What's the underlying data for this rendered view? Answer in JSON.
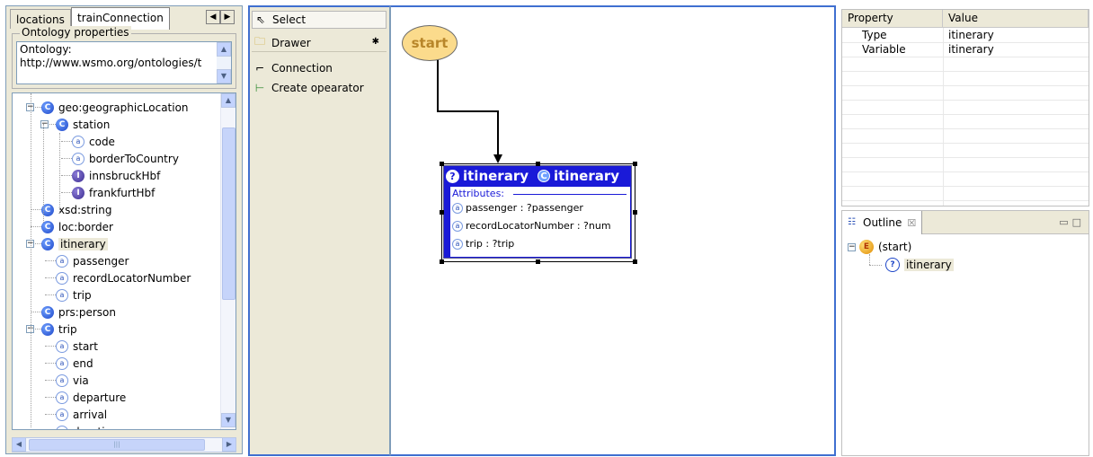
{
  "left_panel": {
    "tabs": [
      "locations",
      "trainConnection"
    ],
    "active_tab": 1,
    "ontology_group_title": "Ontology properties",
    "ontology_label": "Ontology:",
    "ontology_value": "http://www.wsmo.org/ontologies/t",
    "tree": [
      {
        "label": "geo:geographicLocation",
        "icon": "class-icon",
        "level": 1,
        "toggle": "minus"
      },
      {
        "label": "station",
        "icon": "class-icon",
        "level": 2,
        "toggle": "minus"
      },
      {
        "label": "code",
        "icon": "attribute-icon",
        "level": 3
      },
      {
        "label": "borderToCountry",
        "icon": "attribute-icon",
        "level": 3
      },
      {
        "label": "innsbruckHbf",
        "icon": "instance-icon",
        "level": 3
      },
      {
        "label": "frankfurtHbf",
        "icon": "instance-icon",
        "level": 3
      },
      {
        "label": "xsd:string",
        "icon": "class-icon",
        "level": 1
      },
      {
        "label": "loc:border",
        "icon": "class-icon",
        "level": 1
      },
      {
        "label": "itinerary",
        "icon": "class-icon",
        "level": 1,
        "toggle": "minus",
        "selected": true
      },
      {
        "label": "passenger",
        "icon": "attribute-icon",
        "level": 2
      },
      {
        "label": "recordLocatorNumber",
        "icon": "attribute-icon",
        "level": 2
      },
      {
        "label": "trip",
        "icon": "attribute-icon",
        "level": 2
      },
      {
        "label": "prs:person",
        "icon": "class-icon",
        "level": 1
      },
      {
        "label": "trip",
        "icon": "class-icon",
        "level": 1,
        "toggle": "minus"
      },
      {
        "label": "start",
        "icon": "attribute-icon",
        "level": 2
      },
      {
        "label": "end",
        "icon": "attribute-icon",
        "level": 2
      },
      {
        "label": "via",
        "icon": "attribute-icon",
        "level": 2
      },
      {
        "label": "departure",
        "icon": "attribute-icon",
        "level": 2
      },
      {
        "label": "arrival",
        "icon": "attribute-icon",
        "level": 2
      },
      {
        "label": "duration",
        "icon": "attribute-icon",
        "level": 2
      }
    ]
  },
  "palette": {
    "select_label": "Select",
    "drawer_label": "Drawer",
    "connection_label": "Connection",
    "create_operator_label": "Create opearator"
  },
  "canvas": {
    "start_label": "start",
    "node": {
      "title_left": "itinerary",
      "title_right": "itinerary",
      "attributes_label": "Attributes:",
      "attributes": [
        "passenger  :  ?passenger",
        "recordLocatorNumber  :  ?num",
        "trip  :  ?trip"
      ]
    }
  },
  "properties": {
    "headers": [
      "Property",
      "Value"
    ],
    "rows": [
      {
        "property": "Type",
        "value": "itinerary"
      },
      {
        "property": "Variable",
        "value": "itinerary"
      }
    ]
  },
  "outline": {
    "tab_label": "Outline",
    "tab_close": "☒",
    "items": [
      {
        "label": "(start)",
        "icon": "event-icon",
        "level": 0,
        "toggle": "minus"
      },
      {
        "label": "itinerary",
        "icon": "question-icon",
        "level": 1
      }
    ]
  },
  "colors": {
    "node_fill": "#1a1ad8",
    "start_fill": "#fbdb8c",
    "focus_border": "#3f6fd0"
  }
}
